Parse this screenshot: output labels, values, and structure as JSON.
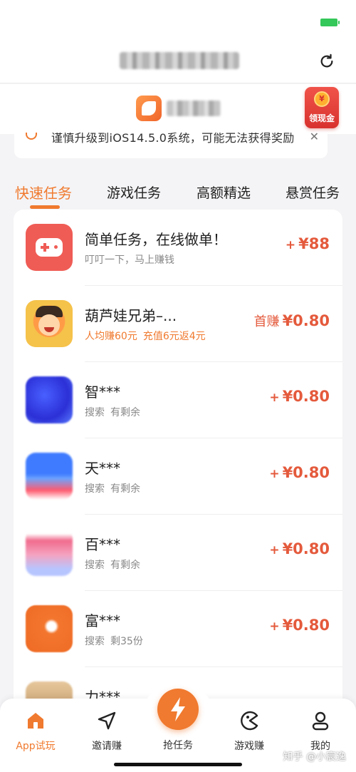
{
  "header": {
    "cash_button_label": "领现金",
    "cash_coin_symbol": "¥"
  },
  "notice": {
    "text": "谨慎升级到iOS14.5.0系统，可能无法获得奖励",
    "close_symbol": "✕"
  },
  "tabs": [
    {
      "label": "快速任务",
      "active": true
    },
    {
      "label": "游戏任务",
      "active": false
    },
    {
      "label": "高额精选",
      "active": false
    },
    {
      "label": "悬赏任务",
      "active": false
    }
  ],
  "tasks": [
    {
      "title": "简单任务，在线做单！",
      "sub1": "叮叮一下，马上赚钱",
      "sub2": "",
      "reward_prefix": "+",
      "reward": "¥88",
      "icon": "gamepad-icon"
    },
    {
      "title": "葫芦娃兄弟–...",
      "sub1": "人均赚60元",
      "sub2": "充值6元返4元",
      "reward_prefix": "首赚",
      "reward": "¥0.80",
      "icon": "gourd-brothers-app-icon"
    },
    {
      "title": "智***",
      "sub1": "搜索",
      "sub2": "有剩余",
      "reward_prefix": "+",
      "reward": "¥0.80",
      "icon": "blurred-app-icon"
    },
    {
      "title": "天***",
      "sub1": "搜索",
      "sub2": "有剩余",
      "reward_prefix": "+",
      "reward": "¥0.80",
      "icon": "blurred-app-icon"
    },
    {
      "title": "百***",
      "sub1": "搜索",
      "sub2": "有剩余",
      "reward_prefix": "+",
      "reward": "¥0.80",
      "icon": "blurred-app-icon"
    },
    {
      "title": "富***",
      "sub1": "搜索",
      "sub2": "剩35份",
      "reward_prefix": "+",
      "reward": "¥0.80",
      "icon": "blurred-app-icon"
    },
    {
      "title": "力***",
      "sub1": "",
      "sub2": "",
      "reward_prefix": "",
      "reward": "",
      "icon": "blurred-app-icon"
    }
  ],
  "bottom_nav": {
    "items": [
      {
        "label": "App试玩",
        "icon": "home-icon",
        "active": true
      },
      {
        "label": "邀请赚",
        "icon": "send-arrow-icon",
        "active": false
      },
      {
        "label": "抢任务",
        "icon": "lightning-icon",
        "active": false
      },
      {
        "label": "游戏赚",
        "icon": "pacman-icon",
        "active": false
      },
      {
        "label": "我的",
        "icon": "person-icon",
        "active": false
      }
    ]
  },
  "watermark": "知乎 @小宸逸",
  "colors": {
    "accent": "#f07a2f",
    "reward": "#e45a3c",
    "cash_red": "#d8322e"
  }
}
